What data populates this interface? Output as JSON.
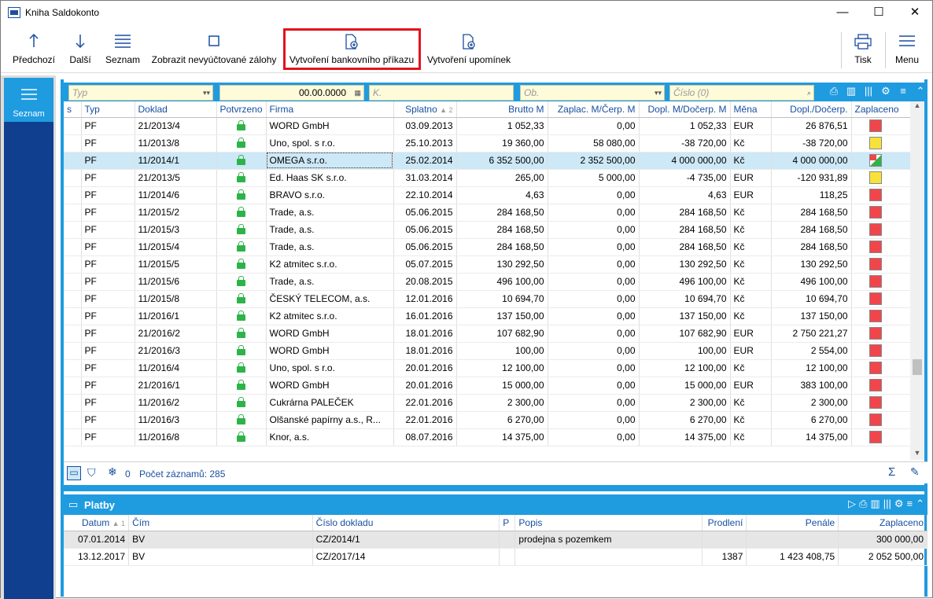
{
  "window": {
    "title": "Kniha Saldokonto"
  },
  "toolbar": {
    "prev": "Předchozí",
    "next": "Další",
    "list": "Seznam",
    "show_advances": "Zobrazit nevyúčtované zálohy",
    "create_bank_order": "Vytvoření bankovního příkazu",
    "create_reminders": "Vytvoření upomínek",
    "print": "Tisk",
    "menu": "Menu"
  },
  "leftnav": {
    "seznam": "Seznam"
  },
  "filters": {
    "typ_placeholder": "Typ",
    "date_value": "00.00.0000",
    "k_placeholder": "K.",
    "ob_placeholder": "Ob.",
    "cislo_placeholder": "Číslo (0)"
  },
  "grid": {
    "columns": [
      "s",
      "Typ",
      "Doklad",
      "Potvrzeno",
      "Firma",
      "Splatno",
      "Brutto M",
      "Zaplac. M/Čerp. M",
      "Dopl. M/Dočerp. M",
      "Měna",
      "Dopl./Dočerp.",
      "Zaplaceno"
    ],
    "sort_indicator": "▲ 2",
    "rows": [
      {
        "typ": "PF",
        "doklad": "21/2013/4",
        "firma": "WORD GmbH",
        "splatno": "03.09.2013",
        "brutto": "1 052,33",
        "zaplac": "0,00",
        "dopl_m": "1 052,33",
        "mena": "EUR",
        "dopl": "26 876,51",
        "status": "red"
      },
      {
        "typ": "PF",
        "doklad": "11/2013/8",
        "firma": "Uno, spol. s r.o.",
        "splatno": "25.10.2013",
        "brutto": "19 360,00",
        "zaplac": "58 080,00",
        "dopl_m": "-38 720,00",
        "mena": "Kč",
        "dopl": "-38 720,00",
        "status": "yellow"
      },
      {
        "typ": "PF",
        "doklad": "11/2014/1",
        "firma": "OMEGA s.r.o.",
        "splatno": "25.02.2014",
        "brutto": "6 352 500,00",
        "zaplac": "2 352 500,00",
        "dopl_m": "4 000 000,00",
        "mena": "Kč",
        "dopl": "4 000 000,00",
        "status": "partial",
        "selected": true
      },
      {
        "typ": "PF",
        "doklad": "21/2013/5",
        "firma": "Ed. Haas SK s.r.o.",
        "splatno": "31.03.2014",
        "brutto": "265,00",
        "zaplac": "5 000,00",
        "dopl_m": "-4 735,00",
        "mena": "EUR",
        "dopl": "-120 931,89",
        "status": "yellow"
      },
      {
        "typ": "PF",
        "doklad": "11/2014/6",
        "firma": "BRAVO s.r.o.",
        "splatno": "22.10.2014",
        "brutto": "4,63",
        "zaplac": "0,00",
        "dopl_m": "4,63",
        "mena": "EUR",
        "dopl": "118,25",
        "status": "red"
      },
      {
        "typ": "PF",
        "doklad": "11/2015/2",
        "firma": "Trade, a.s.",
        "splatno": "05.06.2015",
        "brutto": "284 168,50",
        "zaplac": "0,00",
        "dopl_m": "284 168,50",
        "mena": "Kč",
        "dopl": "284 168,50",
        "status": "red"
      },
      {
        "typ": "PF",
        "doklad": "11/2015/3",
        "firma": "Trade, a.s.",
        "splatno": "05.06.2015",
        "brutto": "284 168,50",
        "zaplac": "0,00",
        "dopl_m": "284 168,50",
        "mena": "Kč",
        "dopl": "284 168,50",
        "status": "red"
      },
      {
        "typ": "PF",
        "doklad": "11/2015/4",
        "firma": "Trade, a.s.",
        "splatno": "05.06.2015",
        "brutto": "284 168,50",
        "zaplac": "0,00",
        "dopl_m": "284 168,50",
        "mena": "Kč",
        "dopl": "284 168,50",
        "status": "red"
      },
      {
        "typ": "PF",
        "doklad": "11/2015/5",
        "firma": "K2 atmitec s.r.o.",
        "splatno": "05.07.2015",
        "brutto": "130 292,50",
        "zaplac": "0,00",
        "dopl_m": "130 292,50",
        "mena": "Kč",
        "dopl": "130 292,50",
        "status": "red"
      },
      {
        "typ": "PF",
        "doklad": "11/2015/6",
        "firma": "Trade, a.s.",
        "splatno": "20.08.2015",
        "brutto": "496 100,00",
        "zaplac": "0,00",
        "dopl_m": "496 100,00",
        "mena": "Kč",
        "dopl": "496 100,00",
        "status": "red"
      },
      {
        "typ": "PF",
        "doklad": "11/2015/8",
        "firma": "ČESKÝ TELECOM, a.s.",
        "splatno": "12.01.2016",
        "brutto": "10 694,70",
        "zaplac": "0,00",
        "dopl_m": "10 694,70",
        "mena": "Kč",
        "dopl": "10 694,70",
        "status": "red"
      },
      {
        "typ": "PF",
        "doklad": "11/2016/1",
        "firma": "K2 atmitec s.r.o.",
        "splatno": "16.01.2016",
        "brutto": "137 150,00",
        "zaplac": "0,00",
        "dopl_m": "137 150,00",
        "mena": "Kč",
        "dopl": "137 150,00",
        "status": "red"
      },
      {
        "typ": "PF",
        "doklad": "21/2016/2",
        "firma": "WORD GmbH",
        "splatno": "18.01.2016",
        "brutto": "107 682,90",
        "zaplac": "0,00",
        "dopl_m": "107 682,90",
        "mena": "EUR",
        "dopl": "2 750 221,27",
        "status": "red"
      },
      {
        "typ": "PF",
        "doklad": "21/2016/3",
        "firma": "WORD GmbH",
        "splatno": "18.01.2016",
        "brutto": "100,00",
        "zaplac": "0,00",
        "dopl_m": "100,00",
        "mena": "EUR",
        "dopl": "2 554,00",
        "status": "red"
      },
      {
        "typ": "PF",
        "doklad": "11/2016/4",
        "firma": "Uno, spol. s r.o.",
        "splatno": "20.01.2016",
        "brutto": "12 100,00",
        "zaplac": "0,00",
        "dopl_m": "12 100,00",
        "mena": "Kč",
        "dopl": "12 100,00",
        "status": "red"
      },
      {
        "typ": "PF",
        "doklad": "21/2016/1",
        "firma": "WORD GmbH",
        "splatno": "20.01.2016",
        "brutto": "15 000,00",
        "zaplac": "0,00",
        "dopl_m": "15 000,00",
        "mena": "EUR",
        "dopl": "383 100,00",
        "status": "red"
      },
      {
        "typ": "PF",
        "doklad": "11/2016/2",
        "firma": "Cukrárna PALEČEK",
        "splatno": "22.01.2016",
        "brutto": "2 300,00",
        "zaplac": "0,00",
        "dopl_m": "2 300,00",
        "mena": "Kč",
        "dopl": "2 300,00",
        "status": "red"
      },
      {
        "typ": "PF",
        "doklad": "11/2016/3",
        "firma": "Olšanské papírny a.s., R...",
        "splatno": "22.01.2016",
        "brutto": "6 270,00",
        "zaplac": "0,00",
        "dopl_m": "6 270,00",
        "mena": "Kč",
        "dopl": "6 270,00",
        "status": "red"
      },
      {
        "typ": "PF",
        "doklad": "11/2016/8",
        "firma": "Knor, a.s.",
        "splatno": "08.07.2016",
        "brutto": "14 375,00",
        "zaplac": "0,00",
        "dopl_m": "14 375,00",
        "mena": "Kč",
        "dopl": "14 375,00",
        "status": "red"
      }
    ]
  },
  "footer": {
    "filter_count": "0",
    "record_count": "Počet záznamů: 285"
  },
  "platby": {
    "title": "Platby",
    "columns": [
      "Datum",
      "Čím",
      "Číslo dokladu",
      "P",
      "Popis",
      "Prodlení",
      "Penále",
      "Zaplaceno"
    ],
    "sort_indicator": "▲ 1",
    "rows": [
      {
        "datum": "07.01.2014",
        "cim": "BV",
        "cislo": "CZ/2014/1",
        "p": "",
        "popis": "prodejna s pozemkem",
        "prodleni": "",
        "penale": "",
        "zaplaceno": "300 000,00"
      },
      {
        "datum": "13.12.2017",
        "cim": "BV",
        "cislo": "CZ/2017/14",
        "p": "",
        "popis": "",
        "prodleni": "1387",
        "penale": "1 423 408,75",
        "zaplaceno": "2 052 500,00"
      }
    ]
  },
  "colors": {
    "accent": "#1f9be0",
    "nav_dark": "#0f3f8e",
    "highlight_box": "#e0141e",
    "header_text": "#1a4fa0",
    "selected_row": "#cde8f6"
  }
}
